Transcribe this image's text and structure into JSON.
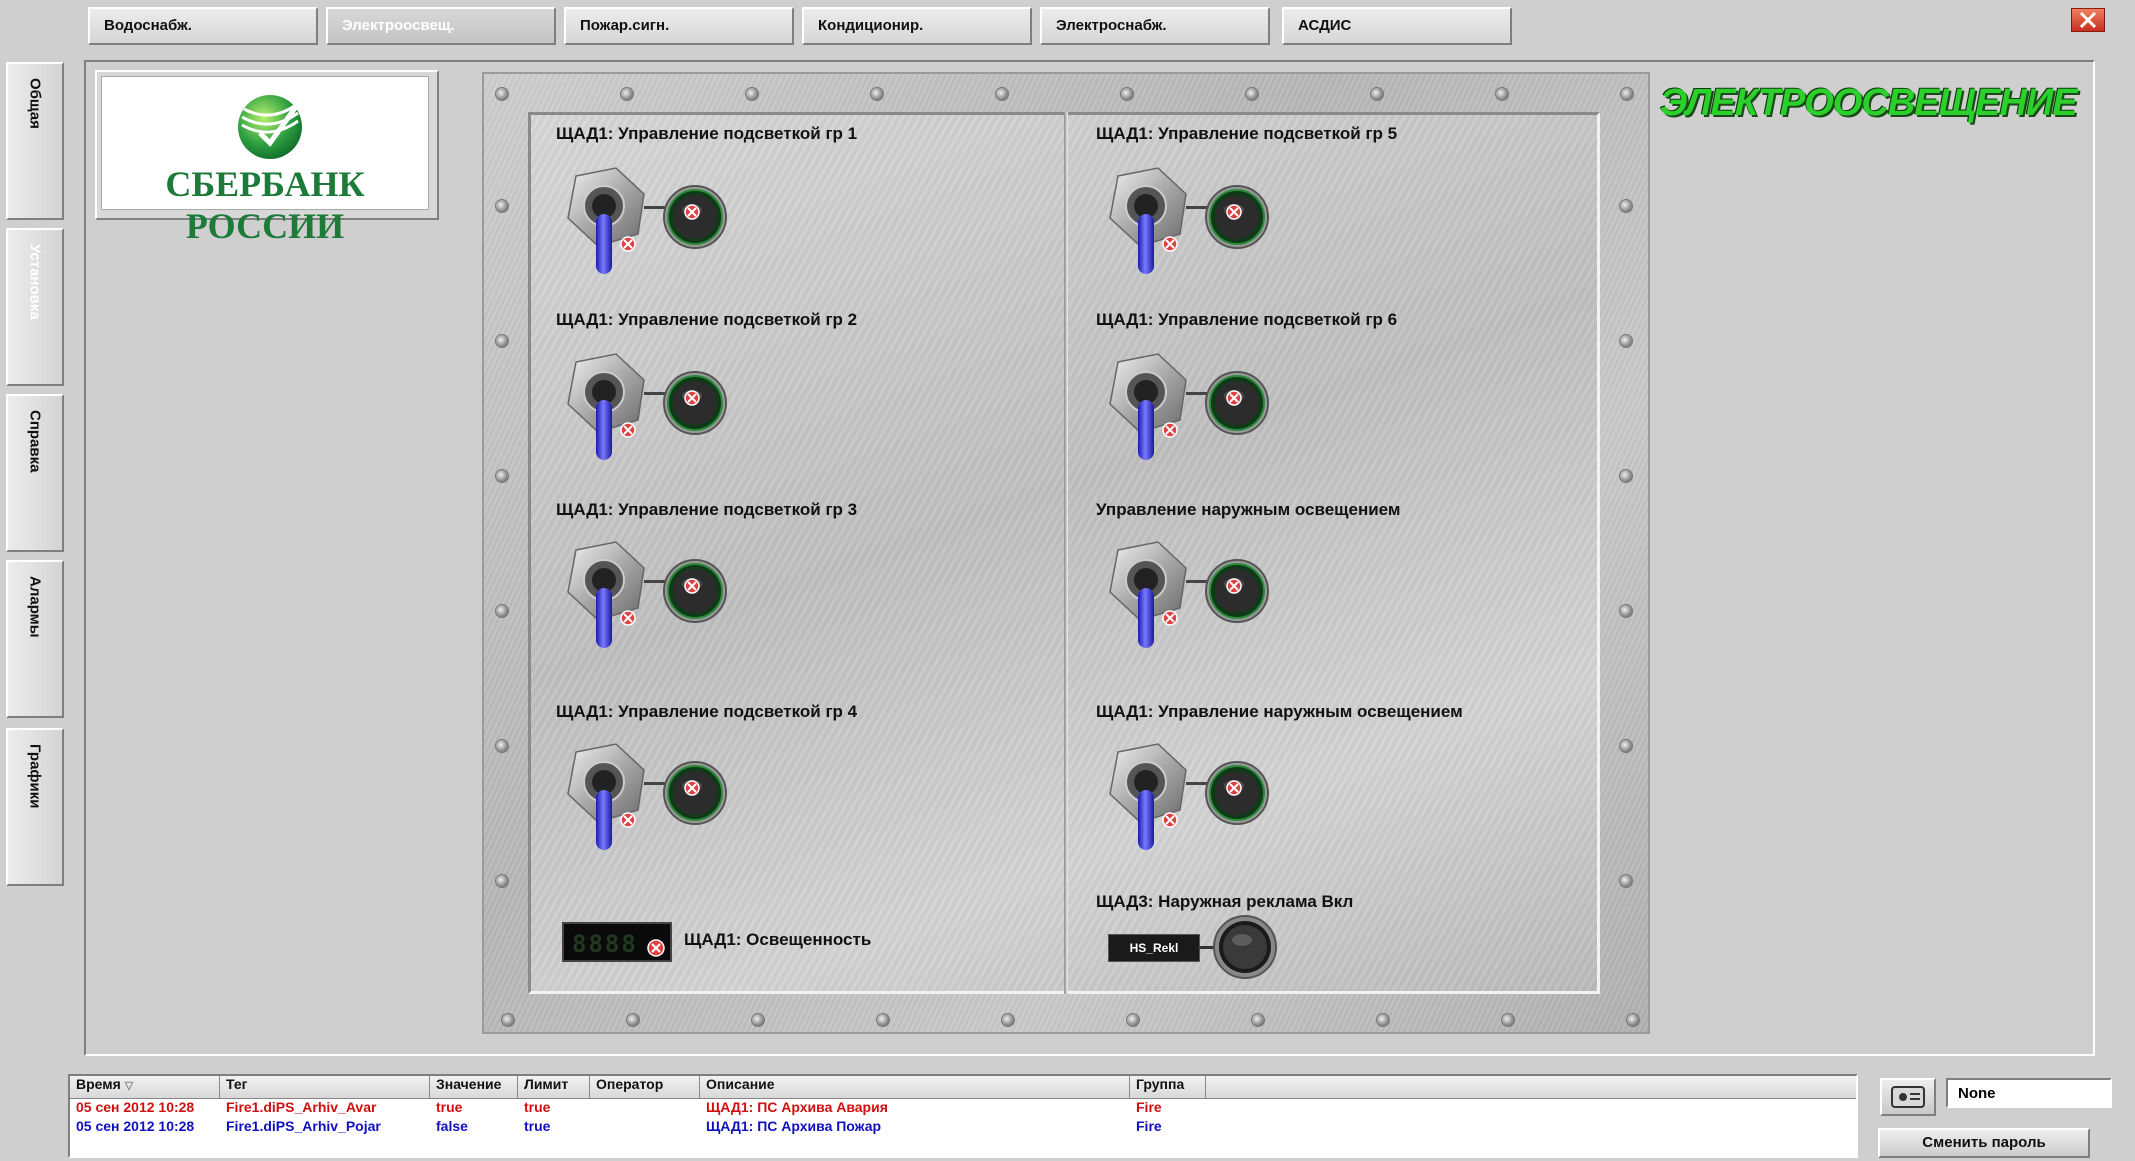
{
  "tabs": [
    "Водоснабж.",
    "Электроосвещ.",
    "Пожар.сигн.",
    "Кондиционир.",
    "Электроснабж.",
    "АСДИС"
  ],
  "side_tabs": [
    "Общая",
    "Установка",
    "Справка",
    "Алармы",
    "Графики"
  ],
  "logo": {
    "text": "СБЕРБАНК РОССИИ"
  },
  "page_title": "ЭЛЕКТРООСВЕЩЕНИЕ",
  "panel": {
    "left_controls": [
      "ЩАД1: Управление подсветкой гр 1",
      "ЩАД1: Управление подсветкой гр 2",
      "ЩАД1: Управление подсветкой гр 3",
      "ЩАД1: Управление подсветкой гр 4"
    ],
    "right_controls": [
      "ЩАД1: Управление подсветкой гр 5",
      "ЩАД1: Управление подсветкой гр 6",
      "Управление наружным освещением",
      "ЩАД1: Управление наружным освещением"
    ],
    "illumination_label": "ЩАД1: Освещенность",
    "illumination_display": "8888",
    "ad_label": "ЩАД3: Наружная реклама Вкл",
    "ad_tag": "HS_Rekl"
  },
  "alarm_table": {
    "headers": [
      "Время",
      "Тег",
      "Значение",
      "Лимит",
      "Оператор",
      "Описание",
      "Группа"
    ],
    "rows": [
      {
        "time": "05 сен 2012 10:28",
        "tag": "Fire1.diPS_Arhiv_Avar",
        "value": "true",
        "limit": "true",
        "operator": "",
        "description": "ЩАД1: ПС Архива Авария",
        "group": "Fire",
        "color": "#d01010"
      },
      {
        "time": "05 сен 2012 10:28",
        "tag": "Fire1.diPS_Arhiv_Pojar",
        "value": "false",
        "limit": "true",
        "operator": "",
        "description": "ЩАД1: ПС Архива Пожар",
        "group": "Fire",
        "color": "#1010c0"
      }
    ]
  },
  "user": {
    "name": "None",
    "change_password": "Сменить пароль"
  },
  "colors": {
    "title_green": "#2bd02b",
    "switch_blue": "#3a3ae8",
    "alarm_red": "#d01010",
    "alarm_blue": "#1010c0"
  }
}
